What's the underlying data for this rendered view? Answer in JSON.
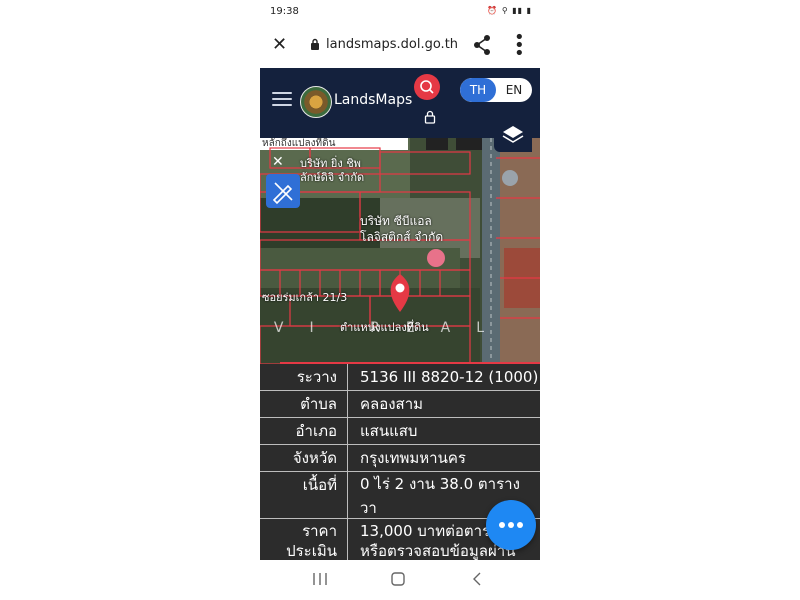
{
  "status_bar": {
    "time": "19:38",
    "icons_text": "⏰ ⚲ ▮▮ ▮"
  },
  "browser": {
    "url": "landsmaps.dol.go.th"
  },
  "app": {
    "name": "LandsMaps",
    "lang_th": "TH",
    "lang_en": "EN"
  },
  "map": {
    "labels": {
      "company1": "บริษัท ซีบีแอล",
      "company2": "โลจิสติกส์ จำกัด",
      "road": "ซอยร่มเกล้า 21/3",
      "marker": "ตำแหน่งแปลงที่ดิน",
      "top1": "บริษัท ยิ่ง ชิพ",
      "top2": "ลักษ์ดิจิ จำกัด",
      "search_snippet": "หลักถึงแปลงที่ดิน"
    },
    "watermark": "LIVI REAL ESTATE"
  },
  "parcel": {
    "rows": [
      {
        "label": "ระวาง",
        "value": "5136 III 8820-12 (1000)"
      },
      {
        "label": "ตำบล",
        "value": "คลองสาม"
      },
      {
        "label": "อำเภอ",
        "value": "แสนแสบ"
      },
      {
        "label": "จังหวัด",
        "value": "กรุงเทพมหานคร"
      },
      {
        "label": "เนื้อที่",
        "value": "0 ไร่ 2 งาน 38.0 ตารางวา"
      },
      {
        "label": "ราคา",
        "value": "13,000 บาทต่อตาร"
      },
      {
        "label": "ประเมิน",
        "value": "หรือตรวจสอบข้อมูลผ่าน"
      }
    ]
  },
  "colors": {
    "appbar": "#14213d",
    "accent_red": "#e53945",
    "accent_blue": "#2f6fd6",
    "fab": "#1e88f3"
  }
}
